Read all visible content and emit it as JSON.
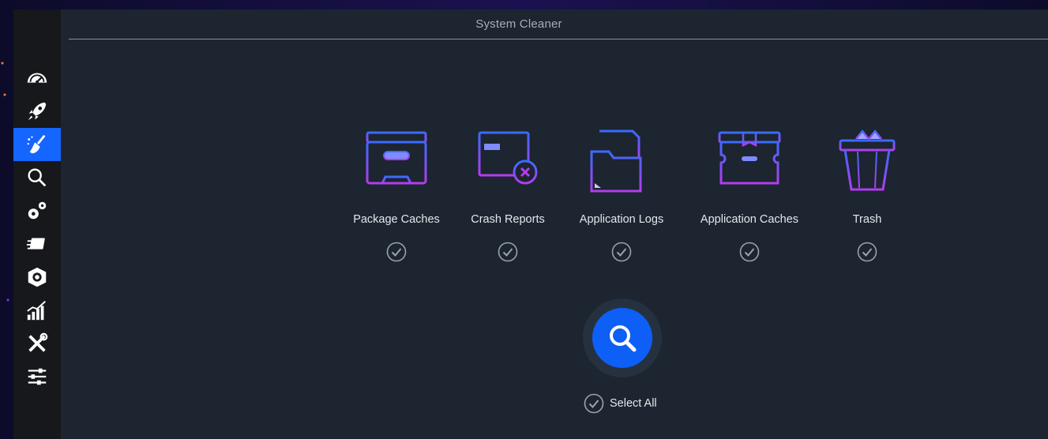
{
  "window": {
    "title": "System Cleaner"
  },
  "sidebar": {
    "items": [
      {
        "icon": "dashboard-gauge-icon",
        "active": false
      },
      {
        "icon": "rocket-icon",
        "active": false
      },
      {
        "icon": "broom-icon",
        "active": true
      },
      {
        "icon": "search-icon",
        "active": false
      },
      {
        "icon": "gears-icon",
        "active": false
      },
      {
        "icon": "services-icon",
        "active": false
      },
      {
        "icon": "package-icon",
        "active": false
      },
      {
        "icon": "chart-icon",
        "active": false
      },
      {
        "icon": "tools-icon",
        "active": false
      },
      {
        "icon": "sliders-icon",
        "active": false
      }
    ]
  },
  "categories": [
    {
      "label": "Package Caches",
      "icon": "package-caches-icon",
      "checked": true
    },
    {
      "label": "Crash Reports",
      "icon": "crash-reports-icon",
      "checked": true
    },
    {
      "label": "Application Logs",
      "icon": "application-logs-icon",
      "checked": true
    },
    {
      "label": "Application Caches",
      "icon": "application-caches-icon",
      "checked": true
    },
    {
      "label": "Trash",
      "icon": "trash-icon",
      "checked": true
    }
  ],
  "scan": {
    "icon": "search-icon"
  },
  "select_all": {
    "label": "Select All",
    "checked": true
  },
  "colors": {
    "accent": "#1565ff",
    "background": "#1c2530",
    "sidebar": "#16181b",
    "icon_gradient_start": "#3a6bff",
    "icon_gradient_end": "#b43cf0"
  }
}
